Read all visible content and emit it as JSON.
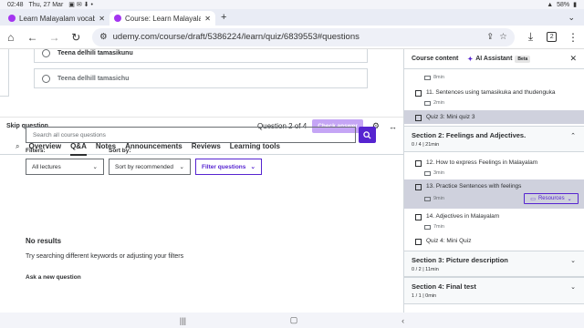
{
  "status": {
    "time": "02:48",
    "date": "Thu, 27 Mar",
    "battery": "58%"
  },
  "tabs": [
    {
      "title": "Learn Malayalam vocabu",
      "active": false
    },
    {
      "title": "Course: Learn Malayalam",
      "active": true
    }
  ],
  "url": "udemy.com/course/draft/5386224/learn/quiz/6839553#questions",
  "browser": {
    "tab_count": "2"
  },
  "quiz": {
    "options": [
      "Teena delhili tamasikunu",
      "Teena delhill tamasichu"
    ],
    "skip_label": "Skip question",
    "question_counter": "Question 2 of 4",
    "check_label": "Check answer"
  },
  "nav_tabs": [
    "Overview",
    "Q&A",
    "Notes",
    "Announcements",
    "Reviews",
    "Learning tools"
  ],
  "qa": {
    "search_placeholder": "Search all course questions",
    "filters_label": "Filters:",
    "sortby_label": "Sort by:",
    "lectures_select": "All lectures",
    "sort_select": "Sort by recommended",
    "filter_questions": "Filter questions",
    "no_results": "No results",
    "try_text": "Try searching different keywords or adjusting your filters",
    "ask_label": "Ask a new question"
  },
  "sidebar": {
    "title": "Course content",
    "ai_label": "AI Assistant",
    "beta": "Beta",
    "items": {
      "d0": "8min",
      "i11": "11. Sentences using tamasikuka and thudenguka",
      "d11": "2min",
      "quiz3": "Quiz 3: Mini quiz 3",
      "i12": "12. How to express Feelings in Malayalam",
      "d12": "3min",
      "i13": "13. Practice Sentences with feelings",
      "d13": "9min",
      "resources": "Resources",
      "i14": "14. Adjectives in Malayalam",
      "d14": "7min",
      "quiz4": "Quiz 4: Mini Quiz"
    },
    "sections": [
      {
        "title": "Section 2: Feelings and Adjectives.",
        "sub": "0 / 4 | 21min"
      },
      {
        "title": "Section 3: Picture description",
        "sub": "0 / 2 | 11min"
      },
      {
        "title": "Section 4: Final test",
        "sub": "1 / 1 | 0min"
      }
    ]
  },
  "colors": {
    "accent": "#5624d0",
    "check_button": "#c5a5f5",
    "highlight": "#cfd1dd"
  }
}
